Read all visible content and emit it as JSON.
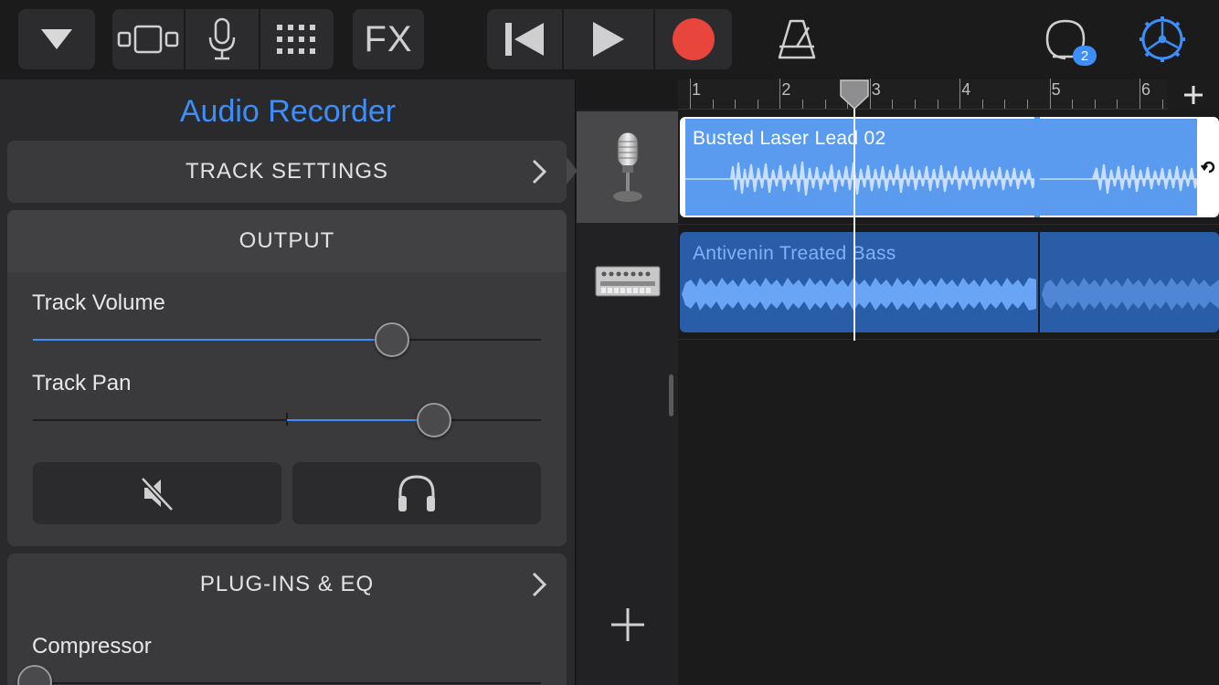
{
  "toolbar": {
    "buttons": [
      {
        "name": "track-menu-button",
        "icon": "triangle-down-icon"
      },
      {
        "name": "view-toggle-button",
        "icon": "tracks-view-icon"
      },
      {
        "name": "instrument-mic-button",
        "icon": "microphone-icon"
      },
      {
        "name": "grid-button",
        "icon": "grid-dots-icon"
      },
      {
        "name": "fx-button",
        "label": "FX"
      },
      {
        "name": "go-to-start-button",
        "icon": "skip-back-icon"
      },
      {
        "name": "play-button",
        "icon": "play-icon"
      },
      {
        "name": "record-button",
        "icon": "record-icon"
      },
      {
        "name": "metronome-button",
        "icon": "metronome-icon"
      },
      {
        "name": "loop-browser-button",
        "icon": "loop-icon",
        "badge": "2"
      },
      {
        "name": "settings-button",
        "icon": "gear-wheel-icon"
      }
    ],
    "fx_label": "FX",
    "loop_badge": "2",
    "record_color": "#e8453c",
    "accent_color": "#3d8ef8"
  },
  "panel": {
    "title": "Audio Recorder",
    "track_settings_label": "TRACK SETTINGS",
    "output_label": "OUTPUT",
    "track_volume_label": "Track Volume",
    "track_volume_value": 0.706,
    "track_pan_label": "Track Pan",
    "track_pan_value": 0.79,
    "mute_icon": "speaker-mute-icon",
    "solo_icon": "headphones-icon",
    "plugins_label": "PLUG-INS & EQ",
    "compressor_label": "Compressor",
    "compressor_value": 0.0
  },
  "tracks": [
    {
      "name": "audio-recorder-track",
      "icon": "microphone-icon",
      "selected": true
    },
    {
      "name": "bass-synth-track",
      "icon": "drum-machine-icon",
      "selected": false
    }
  ],
  "add_track_icon": "plus-icon",
  "timeline": {
    "bars": [
      "1",
      "2",
      "3",
      "4",
      "5",
      "6"
    ],
    "playhead_bar": 2.8,
    "add_section_icon": "plus-icon",
    "regions": [
      {
        "name": "Busted Laser Lead 02",
        "track": 0,
        "selected": true,
        "color": "#5a9bf0"
      },
      {
        "name": "Antivenin Treated Bass",
        "track": 1,
        "selected": false,
        "color": "#2a5da8"
      }
    ]
  }
}
